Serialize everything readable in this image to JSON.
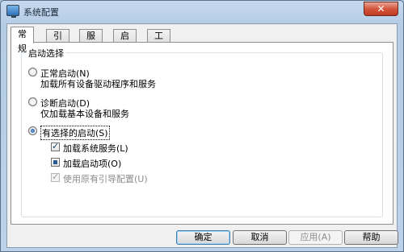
{
  "window": {
    "title": "系统配置",
    "close_label": "✕"
  },
  "tabs": [
    {
      "label": "常规",
      "active": true
    },
    {
      "label": "引导",
      "active": false
    },
    {
      "label": "服务",
      "active": false
    },
    {
      "label": "启动",
      "active": false
    },
    {
      "label": "工具",
      "active": false
    }
  ],
  "startup_selection": {
    "group_title": "启动选择",
    "options": [
      {
        "label": "正常启动(N)",
        "description": "加载所有设备驱动程序和服务",
        "selected": false
      },
      {
        "label": "诊断启动(D)",
        "description": "仅加载基本设备和服务",
        "selected": false
      },
      {
        "label": "有选择的启动(S)",
        "description": "",
        "selected": true
      }
    ],
    "checkboxes": [
      {
        "label": "加载系统服务(L)",
        "state": "checked",
        "enabled": true
      },
      {
        "label": "加载启动项(O)",
        "state": "partial",
        "enabled": true
      },
      {
        "label": "使用原有引导配置(U)",
        "state": "checked",
        "enabled": false
      }
    ]
  },
  "buttons": {
    "ok": "确定",
    "cancel": "取消",
    "apply": "应用(A)",
    "help": "帮助"
  }
}
